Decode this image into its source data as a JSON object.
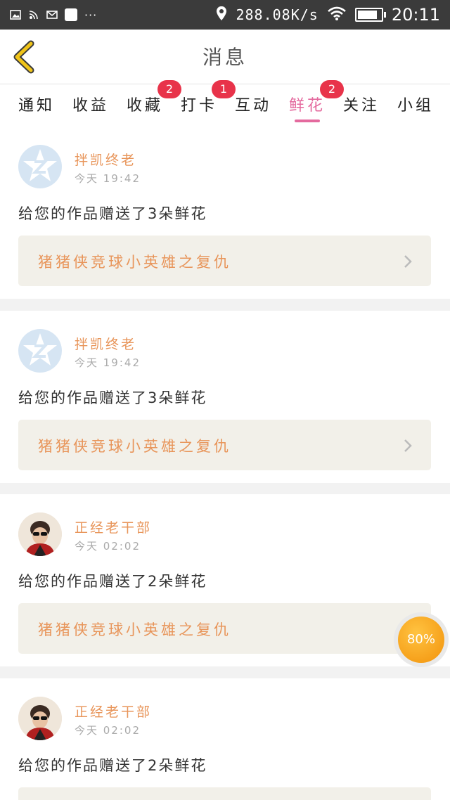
{
  "status_bar": {
    "speed": "288.08K/s",
    "time": "20:11",
    "more": "···",
    "battery_level": 0.85,
    "icons": [
      "image-icon",
      "cast-icon",
      "mail-icon",
      "app-icon",
      "location-icon",
      "wifi-icon",
      "battery-icon"
    ]
  },
  "header": {
    "title": "消息",
    "back_icon": "chevron-left-icon"
  },
  "tabs": [
    {
      "label": "通知",
      "badge": ""
    },
    {
      "label": "收益",
      "badge": ""
    },
    {
      "label": "收藏",
      "badge": "2"
    },
    {
      "label": "打卡",
      "badge": "1"
    },
    {
      "label": "互动",
      "badge": ""
    },
    {
      "label": "鲜花",
      "badge": "2",
      "active": true
    },
    {
      "label": "关注",
      "badge": ""
    },
    {
      "label": "小组",
      "badge": ""
    }
  ],
  "messages": [
    {
      "user": "拌凯终老",
      "time": "今天 19:42",
      "text": "给您的作品赠送了3朵鲜花",
      "work": "猪猪侠竞球小英雄之复仇",
      "avatar": "default-avatar"
    },
    {
      "user": "拌凯终老",
      "time": "今天 19:42",
      "text": "给您的作品赠送了3朵鲜花",
      "work": "猪猪侠竞球小英雄之复仇",
      "avatar": "default-avatar"
    },
    {
      "user": "正经老干部",
      "time": "今天 02:02",
      "text": "给您的作品赠送了2朵鲜花",
      "work": "猪猪侠竞球小英雄之复仇",
      "avatar": "photo-avatar"
    },
    {
      "user": "正经老干部",
      "time": "今天 02:02",
      "text": "给您的作品赠送了2朵鲜花",
      "work": "",
      "avatar": "photo-avatar"
    }
  ],
  "loader": {
    "label": "80%",
    "value": 0.8
  },
  "colors": {
    "accent": "#e46a9e",
    "badge": "#e8334a",
    "username": "#e8955a",
    "link_bg": "#f2f0e9",
    "back_arrow": "#f0c419"
  }
}
